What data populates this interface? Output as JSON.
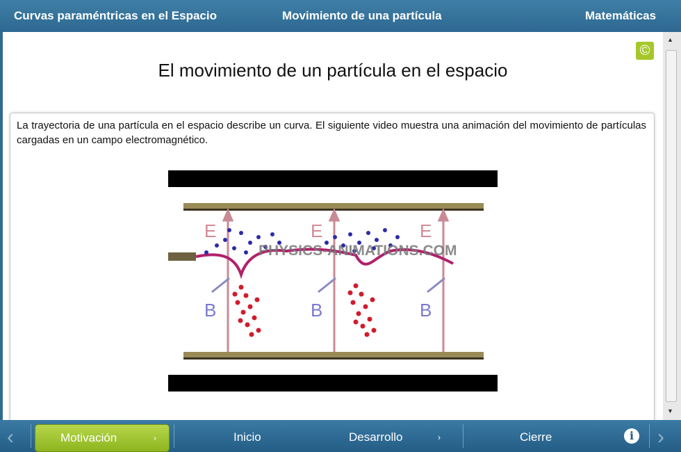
{
  "header": {
    "left": "Curvas paraméntricas en el Espacio",
    "center": "Movimiento de una partícula",
    "right": "Matemáticas"
  },
  "copyright_icon": "©",
  "main": {
    "title": "El movimiento de un partícula en el espacio",
    "paragraph": "La trayectoria de una partícula en el espacio describe un curva. El siguiente video muestra una animación del movimiento de partículas cargadas en un campo electromagnético.",
    "video": {
      "watermark": "PHYSICS-ANIMATIONS.COM",
      "field_e": "E",
      "field_b": "B"
    }
  },
  "nav": {
    "motivacion": "Motivación",
    "inicio": "Inicio",
    "desarrollo": "Desarrollo",
    "cierre": "Cierre",
    "info": "i"
  }
}
